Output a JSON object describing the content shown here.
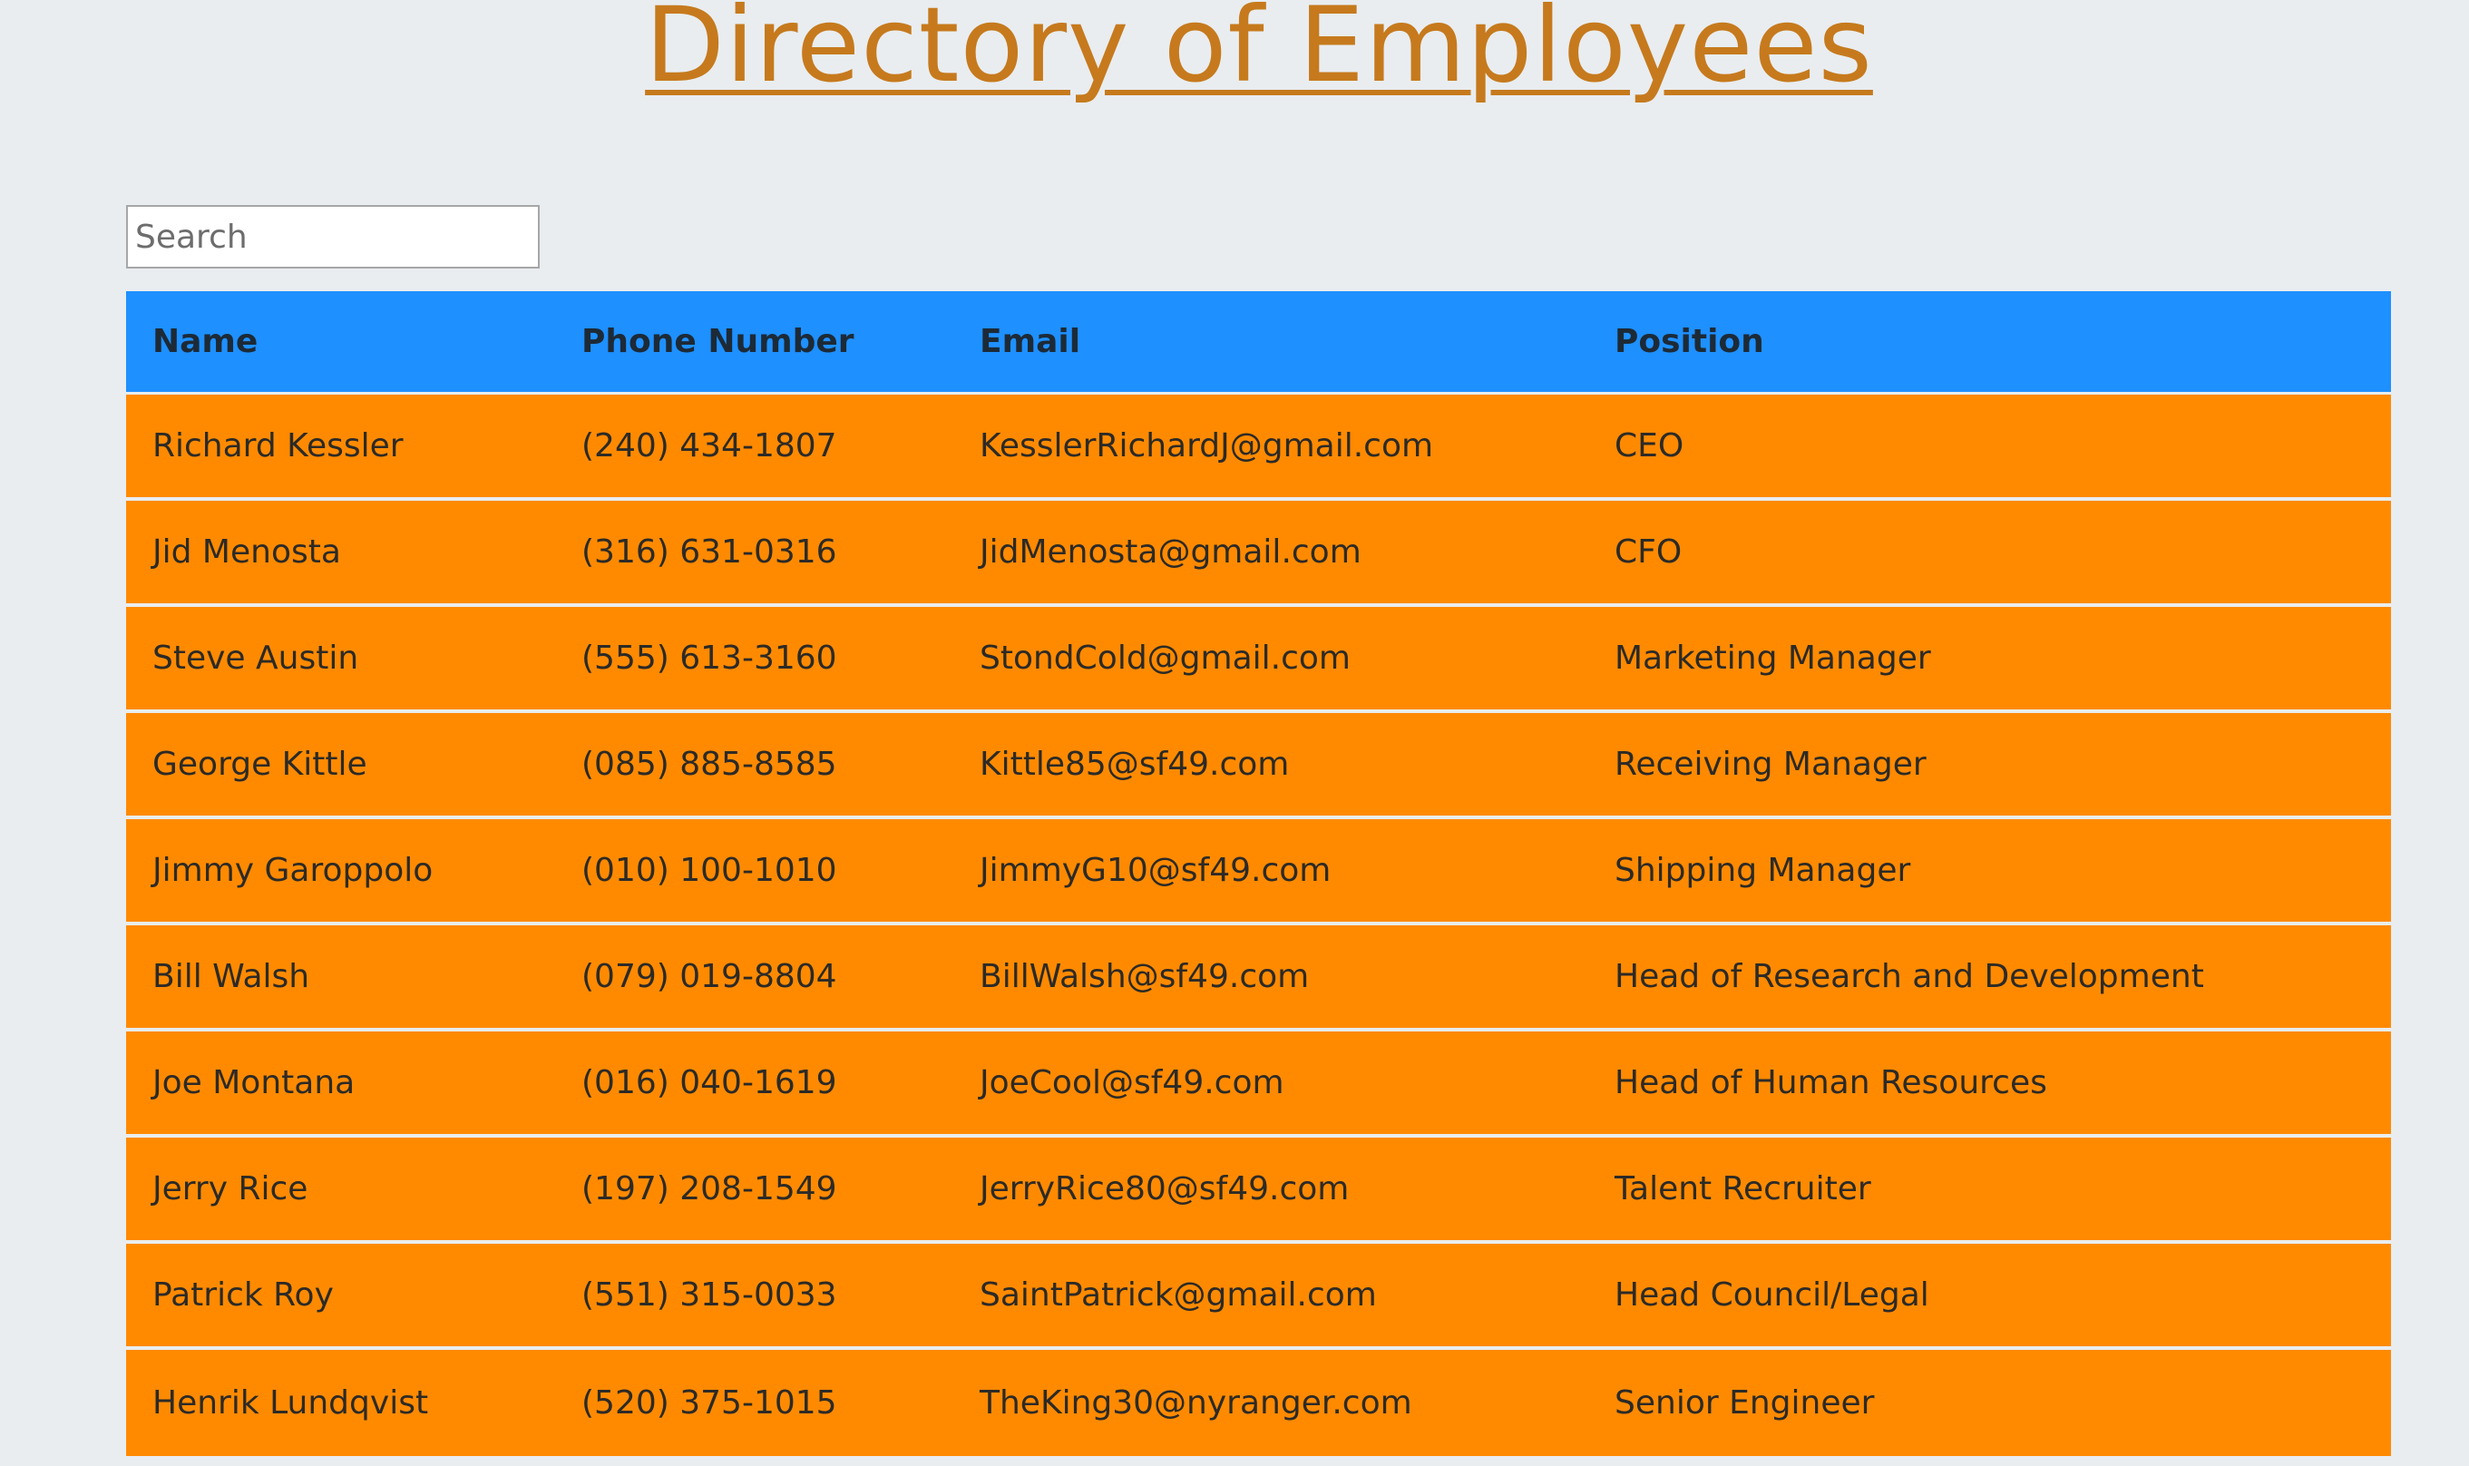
{
  "page": {
    "title": "Directory of Employees"
  },
  "search": {
    "placeholder": "Search",
    "value": ""
  },
  "table": {
    "headers": {
      "name": "Name",
      "phone": "Phone Number",
      "email": "Email",
      "position": "Position"
    },
    "rows": [
      {
        "name": "Richard Kessler",
        "phone": "(240) 434-1807",
        "email": "KesslerRichardJ@gmail.com",
        "position": "CEO"
      },
      {
        "name": "Jid Menosta",
        "phone": "(316) 631-0316",
        "email": "JidMenosta@gmail.com",
        "position": "CFO"
      },
      {
        "name": "Steve Austin",
        "phone": "(555) 613-3160",
        "email": "StondCold@gmail.com",
        "position": "Marketing Manager"
      },
      {
        "name": "George Kittle",
        "phone": "(085) 885-8585",
        "email": "Kittle85@sf49.com",
        "position": "Receiving Manager"
      },
      {
        "name": "Jimmy Garoppolo",
        "phone": "(010) 100-1010",
        "email": "JimmyG10@sf49.com",
        "position": "Shipping Manager"
      },
      {
        "name": "Bill Walsh",
        "phone": "(079) 019-8804",
        "email": "BillWalsh@sf49.com",
        "position": "Head of Research and Development"
      },
      {
        "name": "Joe Montana",
        "phone": "(016) 040-1619",
        "email": "JoeCool@sf49.com",
        "position": "Head of Human Resources"
      },
      {
        "name": "Jerry Rice",
        "phone": "(197) 208-1549",
        "email": "JerryRice80@sf49.com",
        "position": "Talent Recruiter"
      },
      {
        "name": "Patrick Roy",
        "phone": "(551) 315-0033",
        "email": "SaintPatrick@gmail.com",
        "position": "Head Council/Legal"
      },
      {
        "name": "Henrik Lundqvist",
        "phone": "(520) 375-1015",
        "email": "TheKing30@nyranger.com",
        "position": "Senior Engineer"
      }
    ]
  },
  "colors": {
    "background": "#e9edf0",
    "title": "#c67a1d",
    "header_row": "#1e90ff",
    "body_row": "#ff8a00"
  }
}
